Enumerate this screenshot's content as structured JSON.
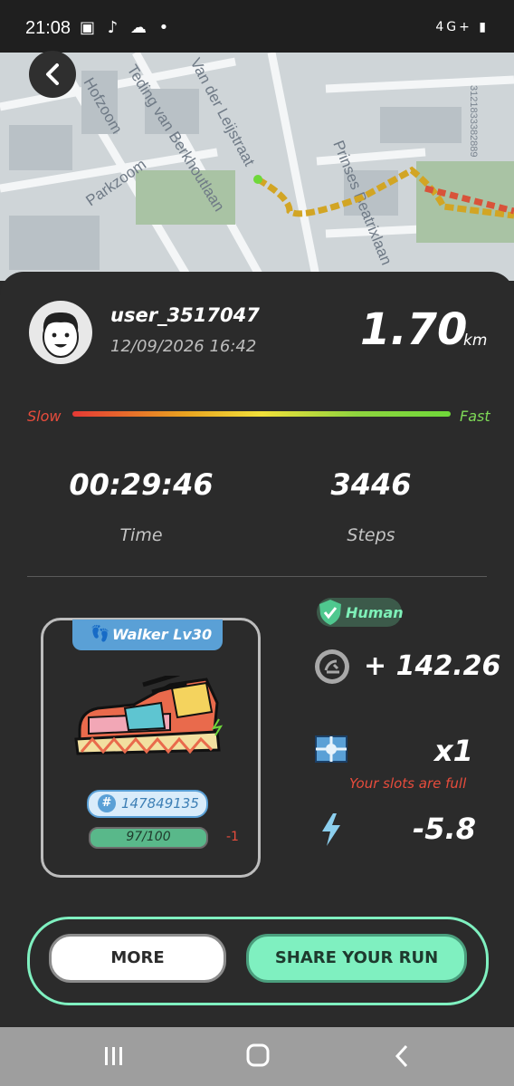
{
  "status_bar": {
    "time": "21:08",
    "left_icons": "▣ ♪ ☁ •",
    "right_icons": "4G+ ▮"
  },
  "map": {
    "streets": [
      "Hofzoom",
      "Teding van Berkhoutlaan",
      "Van der Leijstraat",
      "Parkzoom",
      "Prinses Beatrixlaan"
    ],
    "side_text": "3121833382889"
  },
  "run": {
    "username": "user_3517047",
    "datetime": "12/09/2026 16:42",
    "distance": "1.70",
    "distance_unit": "km",
    "speed_slow_label": "Slow",
    "speed_fast_label": "Fast",
    "time_value": "00:29:46",
    "time_label": "Time",
    "steps_value": "3446",
    "steps_label": "Steps"
  },
  "sneaker": {
    "type_level": "Walker Lv30",
    "id": "147849135",
    "durability": "97/100",
    "durability_fraction": 0.97,
    "durability_change": "-1"
  },
  "rewards": {
    "human_badge": "Human",
    "earned": "+ 142.26",
    "mystery_box_count": "x1",
    "slots_message": "Your slots are full",
    "energy": "-5.8"
  },
  "buttons": {
    "more": "MORE",
    "share": "SHARE YOUR RUN"
  },
  "colors": {
    "accent": "#7ff0c0",
    "card_blue": "#5aa0d6",
    "warning_red": "#e74c3c"
  },
  "icons": [
    "back-arrow-icon",
    "footprint-icon",
    "hash-icon",
    "shield-check-icon",
    "coin-icon",
    "mystery-box-icon",
    "lightning-icon",
    "recents-icon",
    "home-icon",
    "back-icon"
  ]
}
